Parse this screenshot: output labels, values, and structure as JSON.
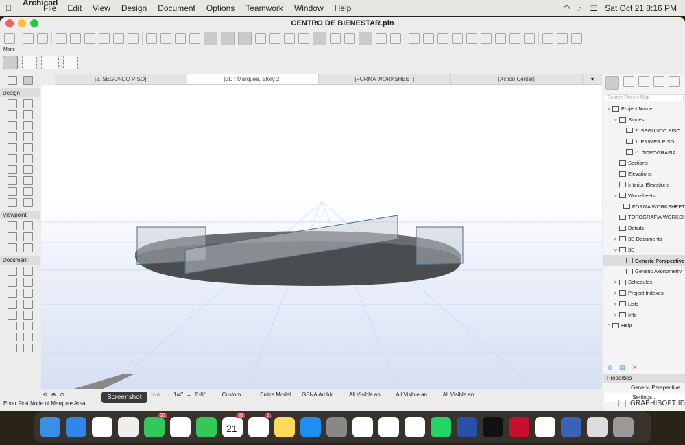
{
  "menubar": {
    "apple": "",
    "app": "Archicad",
    "items": [
      "File",
      "Edit",
      "View",
      "Design",
      "Document",
      "Options",
      "Teamwork",
      "Window",
      "Help"
    ],
    "clock": "Sat Oct 21  8:16 PM"
  },
  "window": {
    "title": "CENTRO DE BIENESTAR.pln"
  },
  "infobox": {
    "label": "Main:"
  },
  "tabs": [
    {
      "label": "[2. SEGUNDO PISO]"
    },
    {
      "label": "[3D / Marquee, Story 2]"
    },
    {
      "label": "[FORMA WORKSHEET]"
    },
    {
      "label": "[Action Center]"
    }
  ],
  "toolbox": {
    "sections": [
      "Design",
      "Viewpoint",
      "Document"
    ]
  },
  "navbar": {
    "na": "N/A",
    "scale": "1/4\"",
    "eq": "=",
    "scale_value": "1'-0\"",
    "custom": "Custom",
    "model": "Entire Model",
    "pen": "GSNA Archic...",
    "layers1": "All Visible an...",
    "layers2": "All Visible an...",
    "layers3": "All Visible an..."
  },
  "status": "Enter First Node of Marquee Area.",
  "tooltip": "Screenshot",
  "project_map": {
    "search_placeholder": "Search Project Map",
    "nodes": [
      {
        "label": "Project Name",
        "lvl": 0,
        "tw": "v"
      },
      {
        "label": "Stories",
        "lvl": 1,
        "tw": "v"
      },
      {
        "label": "2. SEGUNDO PISO",
        "lvl": 2
      },
      {
        "label": "1. PRIMER PISO",
        "lvl": 2
      },
      {
        "label": "-1. TOPOGRAFIA",
        "lvl": 2
      },
      {
        "label": "Sections",
        "lvl": 1
      },
      {
        "label": "Elevations",
        "lvl": 1
      },
      {
        "label": "Interior Elevations",
        "lvl": 1
      },
      {
        "label": "Worksheets",
        "lvl": 1,
        "tw": "v"
      },
      {
        "label": "FORMA WORKSHEET",
        "lvl": 2
      },
      {
        "label": "TOPOGRAFIA WORKSHEET",
        "lvl": 2
      },
      {
        "label": "Details",
        "lvl": 1
      },
      {
        "label": "3D Documents",
        "lvl": 1,
        "tw": ">"
      },
      {
        "label": "3D",
        "lvl": 1,
        "tw": "v"
      },
      {
        "label": "Generic Perspective",
        "lvl": 2,
        "sel": true
      },
      {
        "label": "Generic Axonometry",
        "lvl": 2
      },
      {
        "label": "Schedules",
        "lvl": 1,
        "tw": ">"
      },
      {
        "label": "Project Indexes",
        "lvl": 1,
        "tw": ">"
      },
      {
        "label": "Lists",
        "lvl": 1,
        "tw": ">"
      },
      {
        "label": "Info",
        "lvl": 1,
        "tw": ">"
      },
      {
        "label": "Help",
        "lvl": 0,
        "tw": ">"
      }
    ]
  },
  "properties": {
    "header": "Properties",
    "value": "Generic Perspective",
    "settings": "Settings...",
    "brand": "GRAPHISOFT ID"
  },
  "dock": {
    "apps": [
      {
        "name": "finder",
        "color": "#3a8ee6"
      },
      {
        "name": "safari",
        "color": "#2f86e8"
      },
      {
        "name": "chrome",
        "color": "#ffffff"
      },
      {
        "name": "screenshot",
        "color": "#eeeeee"
      },
      {
        "name": "messages",
        "color": "#34c759",
        "badge": "32"
      },
      {
        "name": "photos",
        "color": "#ffffff"
      },
      {
        "name": "facetime",
        "color": "#34c759"
      },
      {
        "name": "calendar",
        "color": "#ffffff",
        "badge": "31",
        "text": "21"
      },
      {
        "name": "reminders",
        "color": "#ffffff",
        "badge": "1"
      },
      {
        "name": "notes",
        "color": "#ffd95a"
      },
      {
        "name": "app-store",
        "color": "#1e8ef5"
      },
      {
        "name": "system-settings",
        "color": "#888888"
      },
      {
        "name": "powerpoint",
        "color": "#ffffff"
      },
      {
        "name": "word",
        "color": "#ffffff"
      },
      {
        "name": "outlook",
        "color": "#ffffff"
      },
      {
        "name": "whatsapp",
        "color": "#25d366"
      },
      {
        "name": "archicad",
        "color": "#2a4fa8"
      },
      {
        "name": "spotify",
        "color": "#111111"
      },
      {
        "name": "autocad",
        "color": "#c8102e"
      },
      {
        "name": "sketchup",
        "color": "#ffffff"
      },
      {
        "name": "archicad-edu",
        "color": "#3a63b8"
      },
      {
        "name": "archive",
        "color": "#dddddd"
      },
      {
        "name": "trash",
        "color": "#999999"
      }
    ]
  }
}
